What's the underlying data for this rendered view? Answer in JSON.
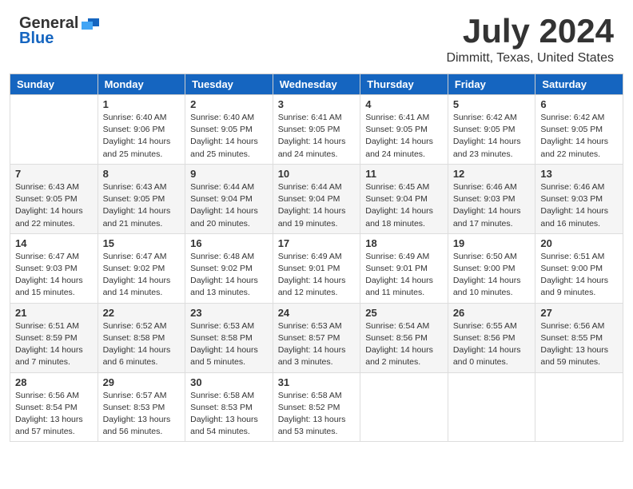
{
  "header": {
    "logo": {
      "general": "General",
      "blue": "Blue"
    },
    "title": "July 2024",
    "location": "Dimmitt, Texas, United States"
  },
  "calendar": {
    "days_of_week": [
      "Sunday",
      "Monday",
      "Tuesday",
      "Wednesday",
      "Thursday",
      "Friday",
      "Saturday"
    ],
    "weeks": [
      [
        {
          "num": "",
          "info": ""
        },
        {
          "num": "1",
          "info": "Sunrise: 6:40 AM\nSunset: 9:06 PM\nDaylight: 14 hours\nand 25 minutes."
        },
        {
          "num": "2",
          "info": "Sunrise: 6:40 AM\nSunset: 9:05 PM\nDaylight: 14 hours\nand 25 minutes."
        },
        {
          "num": "3",
          "info": "Sunrise: 6:41 AM\nSunset: 9:05 PM\nDaylight: 14 hours\nand 24 minutes."
        },
        {
          "num": "4",
          "info": "Sunrise: 6:41 AM\nSunset: 9:05 PM\nDaylight: 14 hours\nand 24 minutes."
        },
        {
          "num": "5",
          "info": "Sunrise: 6:42 AM\nSunset: 9:05 PM\nDaylight: 14 hours\nand 23 minutes."
        },
        {
          "num": "6",
          "info": "Sunrise: 6:42 AM\nSunset: 9:05 PM\nDaylight: 14 hours\nand 22 minutes."
        }
      ],
      [
        {
          "num": "7",
          "info": "Sunrise: 6:43 AM\nSunset: 9:05 PM\nDaylight: 14 hours\nand 22 minutes."
        },
        {
          "num": "8",
          "info": "Sunrise: 6:43 AM\nSunset: 9:05 PM\nDaylight: 14 hours\nand 21 minutes."
        },
        {
          "num": "9",
          "info": "Sunrise: 6:44 AM\nSunset: 9:04 PM\nDaylight: 14 hours\nand 20 minutes."
        },
        {
          "num": "10",
          "info": "Sunrise: 6:44 AM\nSunset: 9:04 PM\nDaylight: 14 hours\nand 19 minutes."
        },
        {
          "num": "11",
          "info": "Sunrise: 6:45 AM\nSunset: 9:04 PM\nDaylight: 14 hours\nand 18 minutes."
        },
        {
          "num": "12",
          "info": "Sunrise: 6:46 AM\nSunset: 9:03 PM\nDaylight: 14 hours\nand 17 minutes."
        },
        {
          "num": "13",
          "info": "Sunrise: 6:46 AM\nSunset: 9:03 PM\nDaylight: 14 hours\nand 16 minutes."
        }
      ],
      [
        {
          "num": "14",
          "info": "Sunrise: 6:47 AM\nSunset: 9:03 PM\nDaylight: 14 hours\nand 15 minutes."
        },
        {
          "num": "15",
          "info": "Sunrise: 6:47 AM\nSunset: 9:02 PM\nDaylight: 14 hours\nand 14 minutes."
        },
        {
          "num": "16",
          "info": "Sunrise: 6:48 AM\nSunset: 9:02 PM\nDaylight: 14 hours\nand 13 minutes."
        },
        {
          "num": "17",
          "info": "Sunrise: 6:49 AM\nSunset: 9:01 PM\nDaylight: 14 hours\nand 12 minutes."
        },
        {
          "num": "18",
          "info": "Sunrise: 6:49 AM\nSunset: 9:01 PM\nDaylight: 14 hours\nand 11 minutes."
        },
        {
          "num": "19",
          "info": "Sunrise: 6:50 AM\nSunset: 9:00 PM\nDaylight: 14 hours\nand 10 minutes."
        },
        {
          "num": "20",
          "info": "Sunrise: 6:51 AM\nSunset: 9:00 PM\nDaylight: 14 hours\nand 9 minutes."
        }
      ],
      [
        {
          "num": "21",
          "info": "Sunrise: 6:51 AM\nSunset: 8:59 PM\nDaylight: 14 hours\nand 7 minutes."
        },
        {
          "num": "22",
          "info": "Sunrise: 6:52 AM\nSunset: 8:58 PM\nDaylight: 14 hours\nand 6 minutes."
        },
        {
          "num": "23",
          "info": "Sunrise: 6:53 AM\nSunset: 8:58 PM\nDaylight: 14 hours\nand 5 minutes."
        },
        {
          "num": "24",
          "info": "Sunrise: 6:53 AM\nSunset: 8:57 PM\nDaylight: 14 hours\nand 3 minutes."
        },
        {
          "num": "25",
          "info": "Sunrise: 6:54 AM\nSunset: 8:56 PM\nDaylight: 14 hours\nand 2 minutes."
        },
        {
          "num": "26",
          "info": "Sunrise: 6:55 AM\nSunset: 8:56 PM\nDaylight: 14 hours\nand 0 minutes."
        },
        {
          "num": "27",
          "info": "Sunrise: 6:56 AM\nSunset: 8:55 PM\nDaylight: 13 hours\nand 59 minutes."
        }
      ],
      [
        {
          "num": "28",
          "info": "Sunrise: 6:56 AM\nSunset: 8:54 PM\nDaylight: 13 hours\nand 57 minutes."
        },
        {
          "num": "29",
          "info": "Sunrise: 6:57 AM\nSunset: 8:53 PM\nDaylight: 13 hours\nand 56 minutes."
        },
        {
          "num": "30",
          "info": "Sunrise: 6:58 AM\nSunset: 8:53 PM\nDaylight: 13 hours\nand 54 minutes."
        },
        {
          "num": "31",
          "info": "Sunrise: 6:58 AM\nSunset: 8:52 PM\nDaylight: 13 hours\nand 53 minutes."
        },
        {
          "num": "",
          "info": ""
        },
        {
          "num": "",
          "info": ""
        },
        {
          "num": "",
          "info": ""
        }
      ]
    ]
  }
}
